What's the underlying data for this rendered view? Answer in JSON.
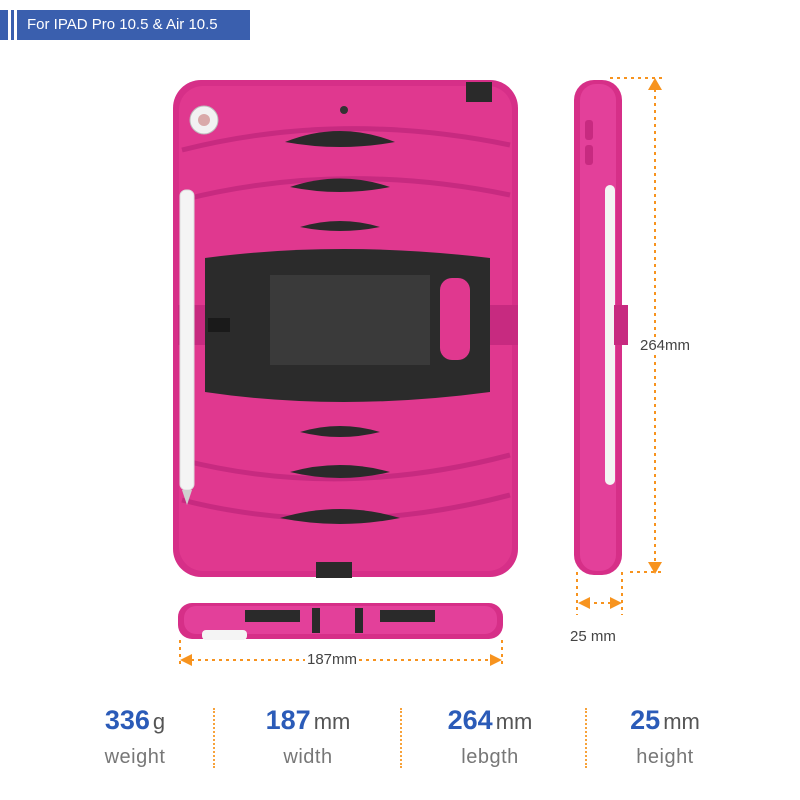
{
  "header": {
    "title": "For IPAD Pro 10.5 & Air 10.5",
    "color": "#3a5fae"
  },
  "product": {
    "case_color": "#e0338f",
    "accent_black": "#2a2a2a"
  },
  "dimensions": {
    "height_label": "264mm",
    "thickness_label": "25 mm",
    "width_label": "187mm",
    "line_color": "#f7931e"
  },
  "specs": [
    {
      "value": "336",
      "unit": "g",
      "label": "weight"
    },
    {
      "value": "187",
      "unit": "mm",
      "label": "width"
    },
    {
      "value": "264",
      "unit": "mm",
      "label": "lebgth"
    },
    {
      "value": "25",
      "unit": "mm",
      "label": "height"
    }
  ]
}
